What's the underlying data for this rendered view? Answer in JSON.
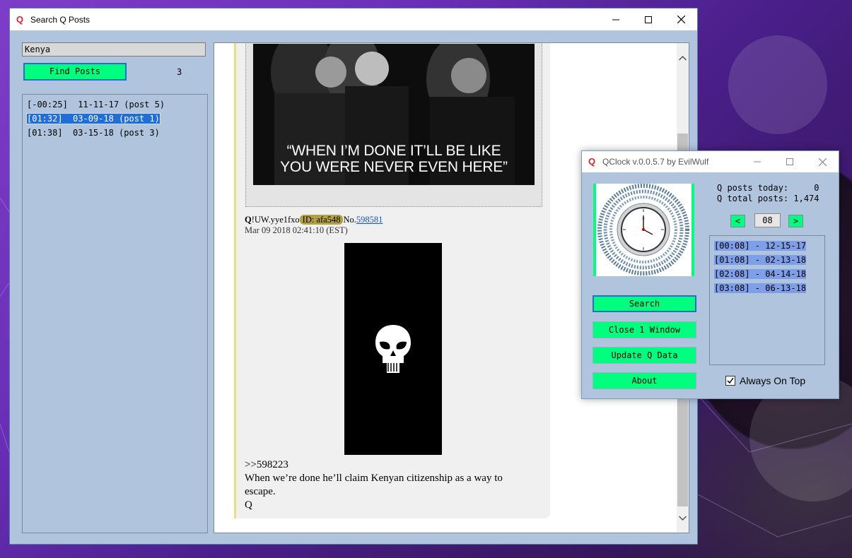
{
  "main_window": {
    "title": "Search Q Posts",
    "search_value": "Kenya",
    "find_button": "Find Posts",
    "result_count": "3",
    "results": [
      {
        "text": "[-00:25]  11-11-17 (post 5)",
        "selected": false
      },
      {
        "text": "[01:32]  03-09-18 (post 1)",
        "selected": true
      },
      {
        "text": "[01:38]  03-15-18 (post 3)",
        "selected": false
      }
    ],
    "post": {
      "photo_caption_line1": "“WHEN I’M DONE IT’LL BE LIKE",
      "photo_caption_line2": "YOU WERE NEVER EVEN HERE”",
      "author_q": "Q",
      "author_trip": "!UW.yye1fxo",
      "id_badge": "ID: afa548",
      "no_label": "No.",
      "post_number": "598581",
      "date": "Mar 09 2018 02:41:10 (EST)",
      "reply_ref": ">>598223",
      "body_line1": "When we’re done he’ll claim Kenyan citizenship as a way to",
      "body_line2": "escape.",
      "signature": "Q"
    }
  },
  "clock_window": {
    "title": "QClock v.0.0.5.7  by EvilWulf",
    "posts_today_label": "Q posts today:     0",
    "total_posts_label": "Q total posts: 1,474",
    "prev_label": "<",
    "next_label": ">",
    "hour_value": "08",
    "hour_matches": [
      "[00:08] - 12-15-17",
      "[01:08] - 02-13-18",
      "[02:08] - 04-14-18",
      "[03:08] - 06-13-18"
    ],
    "buttons": {
      "search": "Search",
      "close_window": "Close 1 Window",
      "update": "Update Q Data",
      "about": "About"
    },
    "always_on_top_label": "Always On Top",
    "always_on_top_checked": true
  },
  "colors": {
    "accent_green": "#00ff7f",
    "window_bg": "#b0c4de",
    "selection_blue": "#1e6fd9",
    "logo_red": "#e0202a"
  }
}
